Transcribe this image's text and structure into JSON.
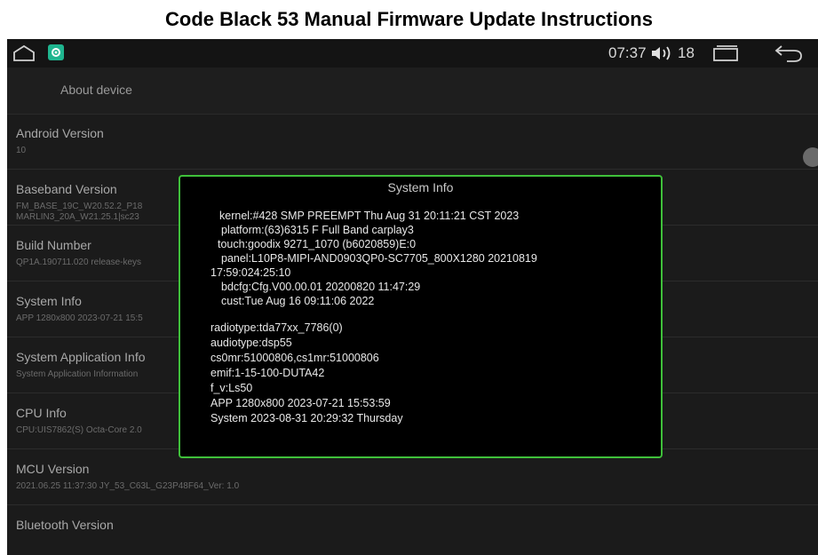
{
  "document": {
    "title": "Code Black 53 Manual Firmware Update Instructions"
  },
  "status_bar": {
    "time": "07:37",
    "volume_level": "18",
    "icons": [
      "home-icon",
      "settings-app-icon",
      "volume-icon",
      "recent-apps-icon",
      "back-icon"
    ]
  },
  "app_bar": {
    "title": "About device"
  },
  "settings": {
    "items": [
      {
        "title": "Android Version",
        "subtitle": "10",
        "subtitle2": ""
      },
      {
        "title": "Baseband Version",
        "subtitle": "FM_BASE_19C_W20.52.2_P18",
        "subtitle2": "MARLIN3_20A_W21.25.1|sc23"
      },
      {
        "title": "Build Number",
        "subtitle": "QP1A.190711.020 release-keys",
        "subtitle2": ""
      },
      {
        "title": "System Info",
        "subtitle": "APP 1280x800 2023-07-21 15:5",
        "subtitle2": ""
      },
      {
        "title": "System Application Info",
        "subtitle": "System Application Information",
        "subtitle2": ""
      },
      {
        "title": "CPU Info",
        "subtitle": "CPU:UIS7862(S) Octa-Core 2.0",
        "subtitle2": ""
      },
      {
        "title": "MCU Version",
        "subtitle": "2021.06.25 11:37:30 JY_53_C63L_G23P48F64_Ver: 1.0",
        "subtitle2": ""
      },
      {
        "title": "Bluetooth Version",
        "subtitle": "",
        "subtitle2": ""
      }
    ]
  },
  "dialog": {
    "title": "System Info",
    "lines": [
      "kernel:#428 SMP PREEMPT Thu Aug 31 20:11:21 CST 2023",
      "platform:(63)6315 F Full Band   carplay3",
      "touch:goodix 9271_1070 (b6020859)E:0",
      "panel:L10P8-MIPI-AND0903QP0-SC7705_800X1280 20210819",
      "17:59:024:25:10",
      "bdcfg:Cfg.V00.00.01 20200820 11:47:29",
      "cust:Tue Aug 16 09:11:06 2022",
      "radiotype:tda77xx_7786(0)",
      "audiotype:dsp55",
      "cs0mr:51000806,cs1mr:51000806",
      "emif:1-15-100-DUTA42",
      "f_v:Ls50",
      "APP 1280x800 2023-07-21 15:53:59",
      "System 2023-08-31 20:29:32 Thursday"
    ]
  },
  "colors": {
    "dialog_border": "#3fc03a",
    "app_icon": "#1fb58f",
    "background": "#1b1b1b"
  }
}
